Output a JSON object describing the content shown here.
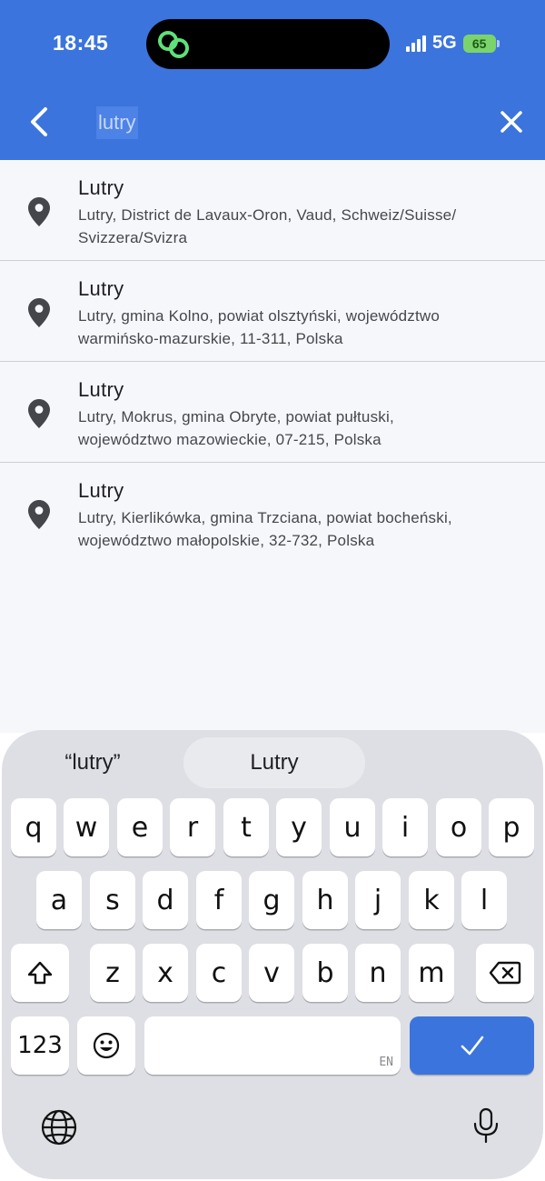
{
  "status": {
    "time": "18:45",
    "network": "5G",
    "battery": "65"
  },
  "search": {
    "query": "lutry"
  },
  "results": [
    {
      "title": "Lutry",
      "line1": "Lutry, District de Lavaux-Oron, Vaud, Schweiz/Suisse/",
      "line2": "Svizzera/Svizra"
    },
    {
      "title": "Lutry",
      "line1": "Lutry, gmina Kolno, powiat olsztyński, województwo",
      "line2": "warmińsko-mazurskie, 11-311, Polska"
    },
    {
      "title": "Lutry",
      "line1": "Lutry, Mokrus, gmina Obryte, powiat pułtuski,",
      "line2": "województwo mazowieckie, 07-215, Polska"
    },
    {
      "title": "Lutry",
      "line1": "Lutry, Kierlikówka, gmina Trzciana, powiat bocheński,",
      "line2": "województwo małopolskie, 32-732, Polska"
    }
  ],
  "keyboard": {
    "suggestions": [
      "“lutry”",
      "Lutry"
    ],
    "row1": [
      "q",
      "w",
      "e",
      "r",
      "t",
      "y",
      "u",
      "i",
      "o",
      "p"
    ],
    "row2": [
      "a",
      "s",
      "d",
      "f",
      "g",
      "h",
      "j",
      "k",
      "l"
    ],
    "row3": [
      "z",
      "x",
      "c",
      "v",
      "b",
      "n",
      "m"
    ],
    "numbers_key": "123",
    "emoji_key": "☺",
    "space_lang": "EN",
    "return_key": "✓"
  },
  "colors": {
    "accent": "#3b74dd",
    "list_bg": "#f6f7fb",
    "keyboard_bg": "#dedfe4"
  }
}
